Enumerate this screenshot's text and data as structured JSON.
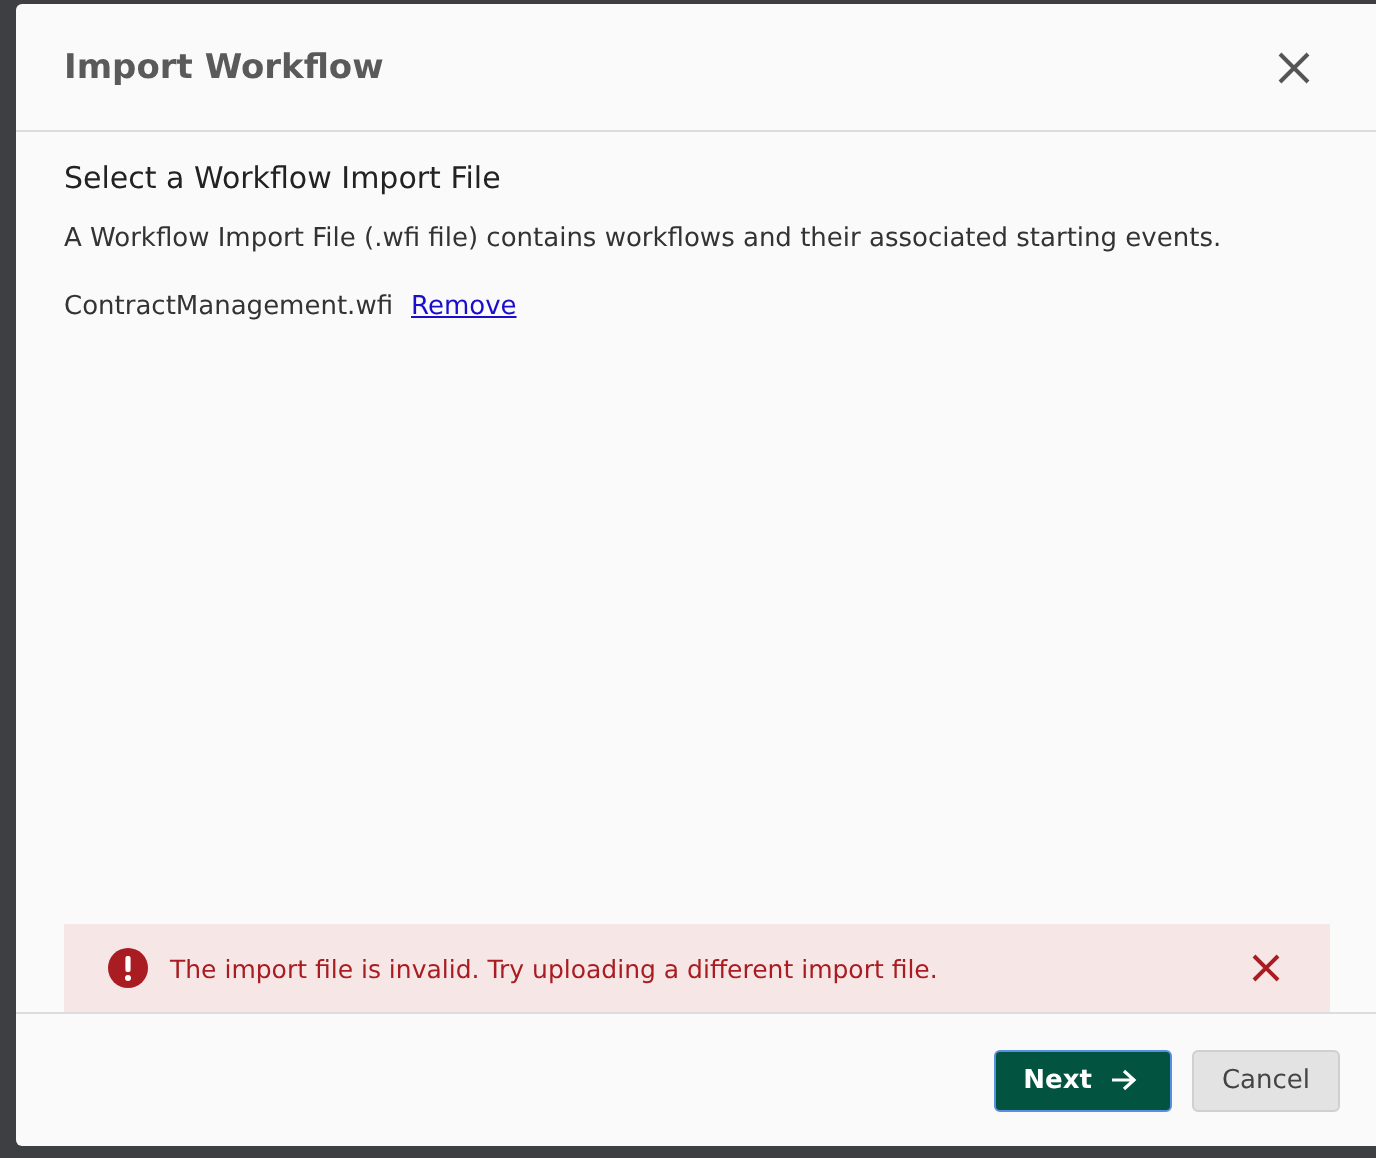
{
  "dialog": {
    "title": "Import Workflow"
  },
  "section": {
    "heading": "Select a Workflow Import File",
    "description": "A Workflow Import File (.wfi file) contains workflows and their associated starting events."
  },
  "file": {
    "name": "ContractManagement.wfi",
    "remove_link": "Remove"
  },
  "error": {
    "message": "The import file is invalid. Try uploading a different import file."
  },
  "buttons": [
    {
      "label": "Next",
      "kind": "primary"
    },
    {
      "label": "Cancel",
      "kind": "secondary"
    }
  ]
}
